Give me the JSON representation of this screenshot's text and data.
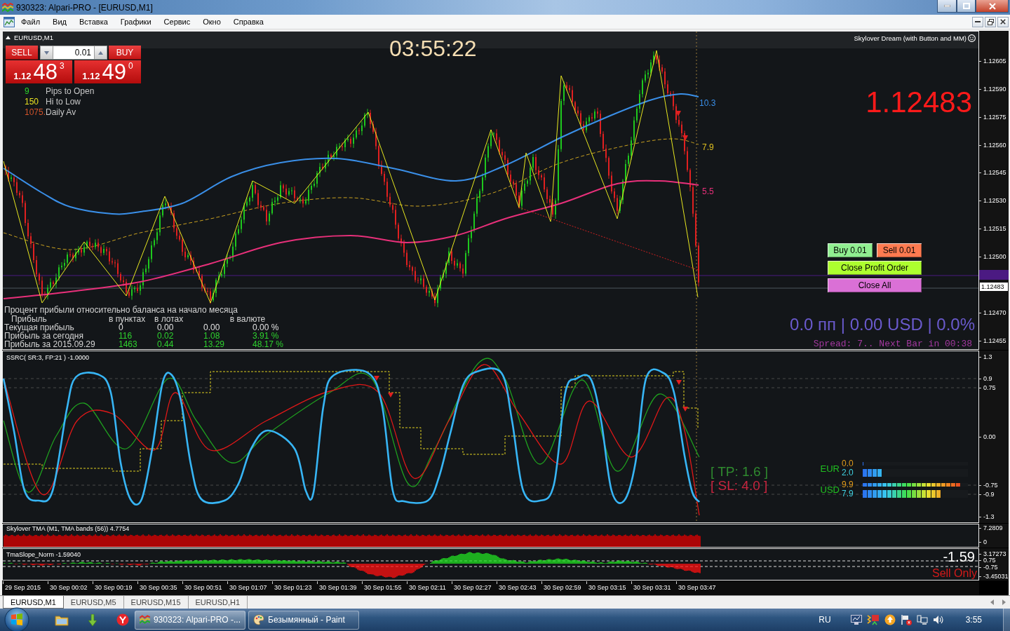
{
  "window": {
    "title": "930323: Alpari-PRO - [EURUSD,M1]"
  },
  "menu": [
    "Файл",
    "Вид",
    "Вставка",
    "Графики",
    "Сервис",
    "Окно",
    "Справка"
  ],
  "main_chart": {
    "symbol": "EURUSD,M1",
    "trade_panel": {
      "sell": "SELL",
      "lot": "0.01",
      "buy": "BUY",
      "bid": {
        "prefix": "1.12",
        "pips": "48",
        "point": "3"
      },
      "ask": {
        "prefix": "1.12",
        "pips": "49",
        "point": "0"
      }
    },
    "clock": "03:55:22",
    "expert": "Skylover Dream (with Button and MM)",
    "stats": [
      {
        "number": "9",
        "text": "Pips to Open",
        "color": "#2ad42a"
      },
      {
        "number": "150",
        "text": "Hi to Low",
        "color": "#e8e020"
      },
      {
        "number": "1075.",
        "text": "Daily Av",
        "color": "#d2522a"
      }
    ],
    "last_price": "1.12483",
    "line_labels": [
      {
        "text": "10.3",
        "color": "#3a8fe8"
      },
      {
        "text": "7.9",
        "color": "#e0c020"
      },
      {
        "text": "5.5",
        "color": "#e8307a"
      }
    ],
    "buttons": [
      {
        "label": "Buy 0.01",
        "color": "#90ee90"
      },
      {
        "label": "Sell 0.01",
        "color": "#ff7a50"
      },
      {
        "label": "Close Profit Order",
        "color": "#adff2f"
      },
      {
        "label": "Close All",
        "color": "#da70d6"
      }
    ],
    "profit_table": {
      "title": "Процент прибыли относительно баланса на начало месяца",
      "columns": [
        "Прибыль",
        "в пунктах",
        "в лотах",
        "в валюте"
      ],
      "rows": [
        {
          "cells": [
            "Текущая прибыль",
            "0",
            "0.00",
            "0.00",
            "0.00 %"
          ],
          "color": "#e0e0e0"
        },
        {
          "cells": [
            "Прибыль за сегодня",
            "116",
            "0.02",
            "1.08",
            "3.91 %"
          ],
          "color": "#2ed22e"
        },
        {
          "cells": [
            "Прибыль за 2015.09.29",
            "1463",
            "0.44",
            "13.29",
            "48.17 %"
          ],
          "color": "#2ed22e"
        }
      ]
    },
    "summary": "0.0 пп | 0.00 USD | 0.0%",
    "status": "Spread: 7.. Next Bar in 00:38",
    "price_axis": [
      "1.12605",
      "1.12590",
      "1.12575",
      "1.12560",
      "1.12545",
      "1.12530",
      "1.12515",
      "1.12500",
      "1.12470",
      "1.12455"
    ],
    "price_marker": "1.12483"
  },
  "oscillator": {
    "title": "SSRC( SR:3, FP:21 ) -1.0000",
    "take_profit": "[ TP: 1.6 ]",
    "stop_loss": "[ SL: 4.0 ]",
    "strength": [
      {
        "currency": "EUR",
        "readings": [
          {
            "kind": "thin",
            "value": "0.0",
            "level": 0.0
          },
          {
            "kind": "thick",
            "value": "2.0",
            "level": 0.19
          }
        ]
      },
      {
        "currency": "USD",
        "readings": [
          {
            "kind": "thin",
            "value": "9.9",
            "level": 0.93
          },
          {
            "kind": "thick",
            "value": "7.9",
            "level": 0.75
          }
        ]
      }
    ],
    "axis": [
      "1.3",
      "0.9",
      "0.75",
      "0.00",
      "-0.75",
      "-0.9",
      "-1.3"
    ]
  },
  "tma": {
    "title": "Skylover TMA (M1, TMA bands (56)) 4.7754",
    "axis": [
      "7.2809",
      "0"
    ]
  },
  "slope": {
    "title": "TmaSlope_Norm -1.59040",
    "value": "-1.59",
    "signal": "Sell Only",
    "axis": [
      "3.17273",
      "0.75",
      "-0.75",
      "-3.45031"
    ]
  },
  "time_axis": [
    "29 Sep 2015",
    "30 Sep 00:02",
    "30 Sep 00:19",
    "30 Sep 00:35",
    "30 Sep 00:51",
    "30 Sep 01:07",
    "30 Sep 01:23",
    "30 Sep 01:39",
    "30 Sep 01:55",
    "30 Sep 02:11",
    "30 Sep 02:27",
    "30 Sep 02:43",
    "30 Sep 02:59",
    "30 Sep 03:15",
    "30 Sep 03:31",
    "30 Sep 03:47"
  ],
  "tabs": [
    {
      "label": "EURUSD,M1",
      "selected": true
    },
    {
      "label": "EURUSD,M5",
      "selected": false
    },
    {
      "label": "EURUSD,M15",
      "selected": false
    },
    {
      "label": "EURUSD,H1",
      "selected": false
    }
  ],
  "taskbar": {
    "tasks": [
      {
        "label": "930323: Alpari-PRO -...",
        "selected": true
      },
      {
        "label": "Безымянный - Paint",
        "selected": false
      }
    ],
    "language": "RU",
    "clock": "3:55"
  }
}
